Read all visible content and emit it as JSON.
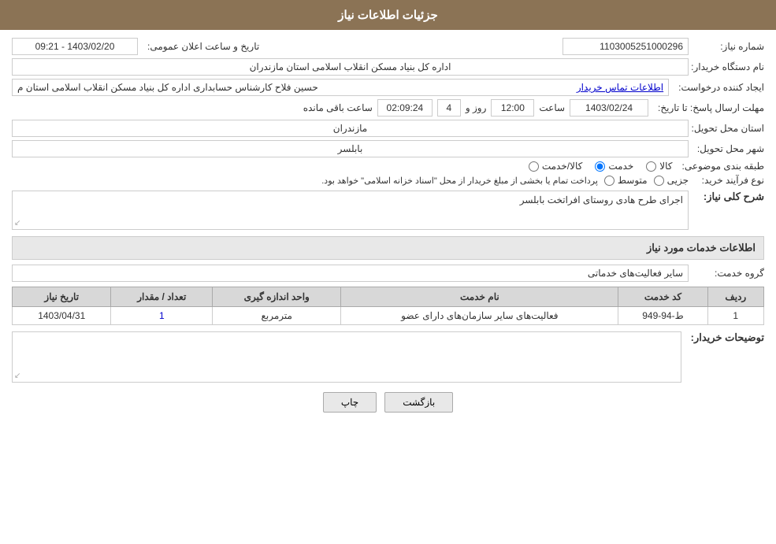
{
  "header": {
    "title": "جزئیات اطلاعات نیاز"
  },
  "fields": {
    "need_number_label": "شماره نیاز:",
    "need_number_value": "1103005251000296",
    "announce_date_label": "تاریخ و ساعت اعلان عمومی:",
    "announce_date_value": "1403/02/20 - 09:21",
    "buyer_org_label": "نام دستگاه خریدار:",
    "buyer_org_value": "اداره کل بنیاد مسکن انقلاب اسلامی استان مازندران",
    "creator_label": "ایجاد کننده درخواست:",
    "creator_value": "حسین فلاح کارشناس حسابداری اداره کل بنیاد مسکن انقلاب اسلامی استان م",
    "contact_link": "اطلاعات تماس خریدار",
    "deadline_label": "مهلت ارسال پاسخ: تا تاریخ:",
    "deadline_date": "1403/02/24",
    "deadline_time_label": "ساعت",
    "deadline_time": "12:00",
    "deadline_day_label": "روز و",
    "deadline_days": "4",
    "deadline_remaining_label": "ساعت باقی مانده",
    "deadline_remaining": "02:09:24",
    "delivery_province_label": "استان محل تحویل:",
    "delivery_province_value": "مازندران",
    "delivery_city_label": "شهر محل تحویل:",
    "delivery_city_value": "بابلسر",
    "category_label": "طبقه بندی موضوعی:",
    "category_options": [
      "کالا",
      "خدمت",
      "کالا/خدمت"
    ],
    "category_selected": "خدمت",
    "purchase_type_label": "نوع فرآیند خرید:",
    "purchase_type_options": [
      "جزیی",
      "متوسط"
    ],
    "purchase_type_note": "پرداخت تمام یا بخشی از مبلغ خریدار از محل \"اسناد خزانه اسلامی\" خواهد بود.",
    "need_desc_label": "شرح کلی نیاز:",
    "need_desc_value": "اجرای طرح هادی روستای افراتخت بابلسر",
    "services_section_label": "اطلاعات خدمات مورد نیاز",
    "service_group_label": "گروه خدمت:",
    "service_group_value": "سایر فعالیت‌های خدماتی",
    "table_headers": [
      "ردیف",
      "کد خدمت",
      "نام خدمت",
      "واحد اندازه گیری",
      "تعداد / مقدار",
      "تاریخ نیاز"
    ],
    "table_rows": [
      {
        "row": "1",
        "code": "ط-94-949",
        "name": "فعالیت‌های سایر سازمان‌های دارای عضو",
        "unit": "مترمربع",
        "quantity": "1",
        "date": "1403/04/31"
      }
    ],
    "buyer_desc_label": "توضیحات خریدار:",
    "buyer_desc_value": "",
    "btn_print": "چاپ",
    "btn_back": "بازگشت"
  }
}
